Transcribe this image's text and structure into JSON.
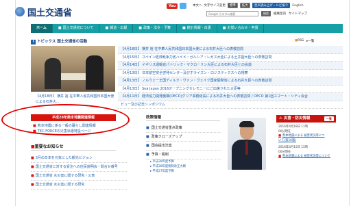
{
  "header": {
    "site_name": "国土交通省",
    "youtube": "You",
    "top_links": [
      "本文へ",
      "文字サイズ変更",
      "標準",
      "拡大",
      "音声読み上げ・ルビ振り",
      "English"
    ],
    "search_placeholder": "Google カスタム検索",
    "search_button": "検索",
    "sub_links": [
      "組織案内",
      "サイトマップ"
    ]
  },
  "nav": {
    "items": [
      "ホーム",
      "国土交通省について",
      "報道・広報",
      "政策・法令・予算",
      "統計情報・白書",
      "お問い合わせ・申請"
    ]
  },
  "topics": {
    "title": "トピックス 国土交通省の活動",
    "rss": "RSS",
    "list": "一覧",
    "photo_caption": "【4月18日】 横井 裕 在中華人民共和国日本国大使による石井大...",
    "news": [
      "【4月18日】 横井 裕 在中華人民共和国日本国大使による石井大臣への表敬訪問",
      "【4月15日】 スペイン経済競争力省ハイメ・ガルシア・レガス大臣による土井副大臣への表敬訪問",
      "【4月14日】 イギリス運輸省パトリック・マクローリン大臣による石井大臣との会談",
      "【4月13日】 日本航空安全啓発センター及びホライズン・ロジスティクスへの視察",
      "【4月13日】 ノルウェー王国ディルク・ヴァン・ヴェイク国家開発省による石井大臣への表敬訪問",
      "【4月13日】 Sea Japan 2016オープニングセレモニーにご出席された大臣等",
      "【4月11日】 経済協力開発機構(OECD)グリア事務総長による石井大臣への表敬訪問 / OECD 第1回スマート・シティ会合",
      "ビュー及び記念シンポジウム"
    ]
  },
  "quake": {
    "title": "平成28年熊本地震関連情報",
    "items": [
      "熊本地震に係る一般の暮らし関連情報",
      "TEC-FORCEの災害派遣特設ページ"
    ]
  },
  "notices": {
    "title": "重要なお知らせ",
    "items": [
      "3月の日本を元気にした観光ビジョン",
      "国土交通省に対する受注への住民説明会・問合せ番号",
      "国土交通省 水災害に関する研究・公表",
      "国土交通省 水災害に関する研究"
    ]
  },
  "policy": {
    "title": "政策情報",
    "items": [
      "国土交通省重点政策",
      "政策クローズアップ",
      "国会提出法案",
      "予算・税制"
    ],
    "sub_items": [
      "平成28年度予算",
      "平成28年度税制改正大綱",
      "平成27年度予算"
    ]
  },
  "disaster": {
    "title": "災害・防災情報",
    "more": "一覧",
    "entries": [
      {
        "date": "2016年4月18日 11時",
        "time": "00分現在",
        "link": "熊本地震による 被害状況等につ",
        "link2": "いて(第16報)"
      },
      {
        "date": "2016年4月15日 15時",
        "time": "00分現在",
        "link": "熊本地震による 被害状況等について"
      }
    ]
  }
}
